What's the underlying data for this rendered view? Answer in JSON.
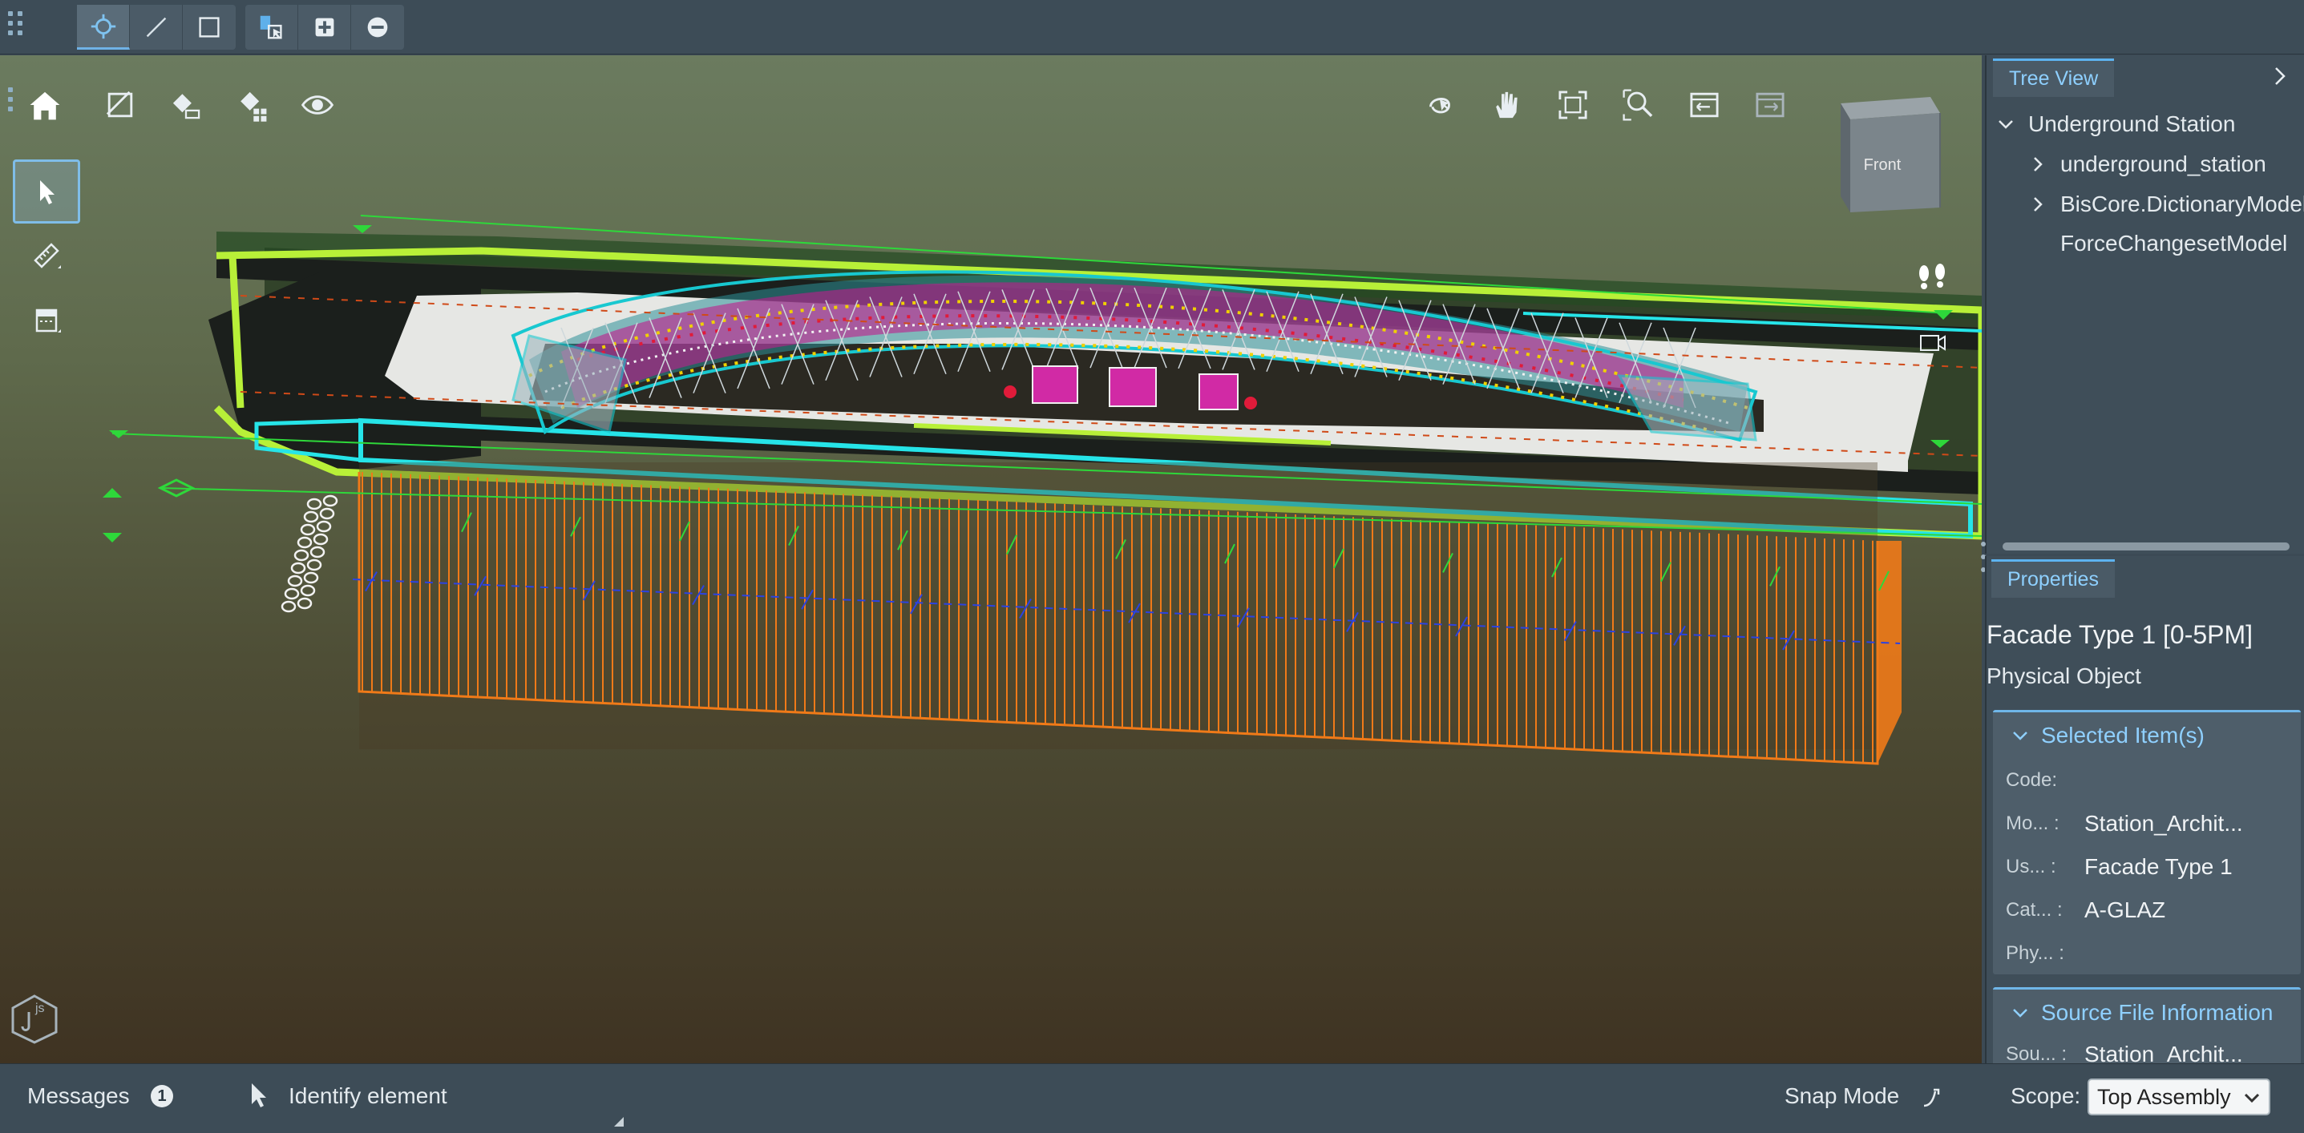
{
  "toolbar": {
    "groups": [
      [
        "accudraw-snap-icon",
        "line-icon",
        "rectangle-icon"
      ],
      [
        "select-tool-icon",
        "zoom-in-icon",
        "zoom-out-icon"
      ]
    ]
  },
  "viewport": {
    "left_tools": [
      "home-icon",
      "section-tool-icon",
      "measure-toggle-icon",
      "isolate-icon",
      "visibility-icon"
    ],
    "view_tools": [
      "rotate-icon",
      "pan-icon",
      "fit-view-icon",
      "zoom-window-icon",
      "view-undo-icon",
      "view-redo-icon"
    ],
    "side_tools": [
      "select-arrow-icon",
      "measure-distance-icon",
      "clipping-icon"
    ],
    "nav_cube_face": "Front",
    "scene_colors": {
      "sky_top": "#6b7b5f",
      "ground_bottom": "#3f3322",
      "outline_lime": "#b8f038",
      "outline_cyan": "#26e4e8",
      "wall_orange": "#f07a18",
      "roof_magenta": "#c21d8c",
      "roof_cyan": "#18c8d0",
      "dimension_green": "#2ed83a"
    }
  },
  "tree": {
    "tab_label": "Tree View",
    "rows": [
      {
        "label": "Underground Station",
        "expanded": true
      },
      {
        "label": "underground_station",
        "expanded": false
      },
      {
        "label": "BisCore.DictionaryModel",
        "expanded": false
      },
      {
        "label": "ForceChangesetModel"
      }
    ]
  },
  "properties": {
    "tab_label": "Properties",
    "element_title": "Facade Type 1 [0-5PM]",
    "element_class": "Physical Object",
    "selected_group": {
      "title": "Selected Item(s)",
      "rows": [
        {
          "label": "Code:",
          "value": ""
        },
        {
          "label": "Mo... :",
          "value": "Station_Archit..."
        },
        {
          "label": "Us... :",
          "value": "Facade Type 1"
        },
        {
          "label": "Cat... :",
          "value": "A-GLAZ"
        },
        {
          "label": "Phy... :",
          "value": ""
        }
      ]
    },
    "source_group": {
      "title": "Source File Information",
      "rows": [
        {
          "label": "Sou... :",
          "value": "Station_Archit..."
        }
      ]
    }
  },
  "status": {
    "messages_label": "Messages",
    "messages_count": "1",
    "tool_prompt": "Identify element",
    "snap_label": "Snap Mode",
    "scope_label": "Scope:",
    "scope_value": "Top Assembly"
  }
}
